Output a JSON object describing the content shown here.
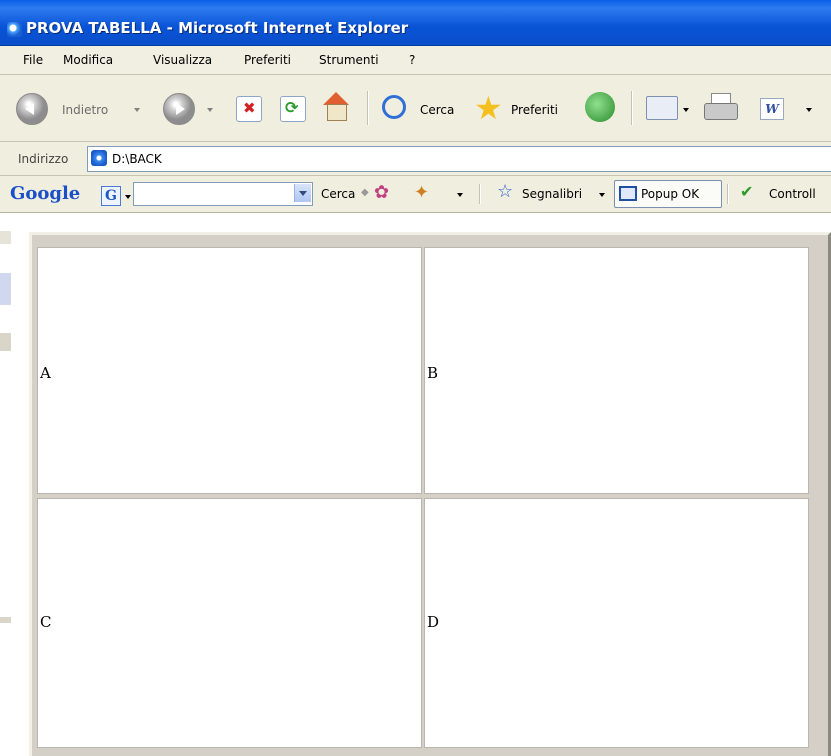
{
  "window": {
    "title": "PROVA TABELLA - Microsoft Internet Explorer"
  },
  "menu": [
    "File",
    "Modifica",
    "Visualizza",
    "Preferiti",
    "Strumenti",
    "?"
  ],
  "toolbar": {
    "back_label": "Indietro",
    "search_label": "Cerca",
    "favorites_label": "Preferiti"
  },
  "address": {
    "label": "Indirizzo",
    "value": "D:\\BACK"
  },
  "google_toolbar": {
    "logo": "Google",
    "search_label": "Cerca",
    "bookmarks_label": "Segnalibri",
    "popup_label": "Popup OK",
    "spell_label": "Controll"
  },
  "table": {
    "cells": [
      "A",
      "B",
      "C",
      "D"
    ]
  }
}
